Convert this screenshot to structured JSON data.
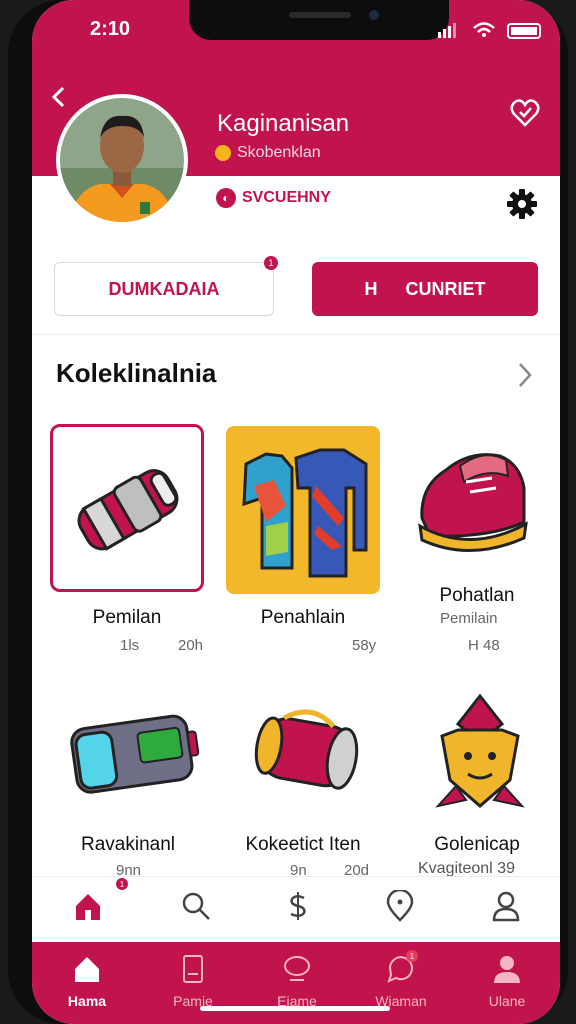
{
  "status_bar": {
    "time": "2:10"
  },
  "profile": {
    "name": "Kaginanisan",
    "subtitle": "Skobenklan",
    "badge_label": "SVCUEHNY"
  },
  "actions": {
    "secondary_label": "DUMKADAIA",
    "secondary_badge": "1",
    "primary_icon_text": "H",
    "primary_label": "CUNRIET"
  },
  "collection": {
    "title": "Koleklinalnia",
    "items": [
      {
        "label": "Pemilan",
        "meta_left": "1ls",
        "meta_right": "20h"
      },
      {
        "label": "Penahlain",
        "meta_left": "",
        "meta_right": "58y"
      },
      {
        "label": "Pohatlan",
        "meta_left": "Pemilain",
        "meta_right": "H   48"
      },
      {
        "label": "Ravakinanl",
        "meta_left": "9nn",
        "meta_right": ""
      },
      {
        "label": "Kokeetict Iten",
        "meta_left": "9n",
        "meta_right": "20d"
      },
      {
        "label": "Golenicap",
        "meta_left": "Kvagiteonl 39",
        "meta_right": ""
      }
    ]
  },
  "tabbar": {
    "home_badge": "1"
  },
  "bottom_nav": {
    "items": [
      {
        "label": "Hama"
      },
      {
        "label": "Pamie"
      },
      {
        "label": "Eiame"
      },
      {
        "label": "Wiaman"
      },
      {
        "label": "Ulane"
      }
    ],
    "badge": "1"
  },
  "colors": {
    "accent": "#c2144c",
    "gold": "#f2b829"
  },
  "icons": [
    "back-icon",
    "heart-icon",
    "gear-icon",
    "chevron-right-icon",
    "home-icon",
    "search-icon",
    "dollar-icon",
    "map-pin-icon",
    "user-icon"
  ]
}
